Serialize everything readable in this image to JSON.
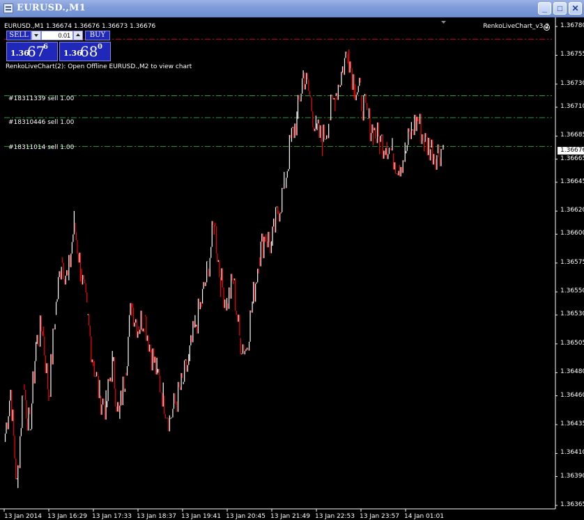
{
  "window": {
    "title": "EURUSD.,M1",
    "minimize_symbol": "_",
    "maximize_symbol": "□",
    "close_symbol": "✕"
  },
  "chart_info": "EURUSD.,M1  1.36674 1.36676 1.36673 1.36676",
  "indicator_name": "RenkoLiveChart_v3.2",
  "renko_message": "RenkoLiveChart(2): Open Offline EURUSD.,M2 to view chart",
  "trade_panel": {
    "sell_label": "SELL",
    "buy_label": "BUY",
    "lot": "0.01",
    "bid": {
      "prefix": "1.36",
      "big": "67",
      "sup": "6"
    },
    "ask": {
      "prefix": "1.36",
      "big": "68",
      "sup": "0"
    }
  },
  "orders": [
    {
      "label": "#18311339 sell 1.00",
      "price": 1.3672
    },
    {
      "label": "#18310446 sell 1.00",
      "price": 1.36701
    },
    {
      "label": "#18311014 sell 1.00",
      "price": 1.36676
    }
  ],
  "current_price": "1.36676",
  "colors": {
    "bear": "#ff0000",
    "bull": "#ffffff",
    "order_line": "#2ba02b",
    "top_line": "#d01010",
    "background": "#000000"
  },
  "chart_data": {
    "type": "line",
    "symbol": "EURUSD.",
    "timeframe": "M1",
    "y_ticks": [
      "1.36780",
      "1.36755",
      "1.36730",
      "1.36710",
      "1.36685",
      "1.36665",
      "1.36645",
      "1.36620",
      "1.36600",
      "1.36575",
      "1.36550",
      "1.36530",
      "1.36505",
      "1.36480",
      "1.36460",
      "1.36435",
      "1.36410",
      "1.36390",
      "1.36365"
    ],
    "x_ticks": [
      "13 Jan 2014",
      "13 Jan 16:29",
      "13 Jan 17:33",
      "13 Jan 18:37",
      "13 Jan 19:41",
      "13 Jan 20:45",
      "13 Jan 21:49",
      "13 Jan 22:53",
      "13 Jan 23:57",
      "14 Jan 01:01"
    ],
    "ylim": [
      1.36362,
      1.36783
    ],
    "top_line_price": 1.36769,
    "close_path": [
      [
        0,
        1.3642
      ],
      [
        1,
        1.36465
      ],
      [
        2,
        1.3638
      ],
      [
        3,
        1.3647
      ],
      [
        4,
        1.3643
      ],
      [
        5,
        1.36505
      ],
      [
        6,
        1.3652
      ],
      [
        7,
        1.3646
      ],
      [
        8,
        1.3653
      ],
      [
        9,
        1.3658
      ],
      [
        10,
        1.3656
      ],
      [
        11,
        1.3661
      ],
      [
        12,
        1.3657
      ],
      [
        13,
        1.3653
      ],
      [
        14,
        1.3649
      ],
      [
        15,
        1.3646
      ],
      [
        16,
        1.3645
      ],
      [
        17,
        1.3649
      ],
      [
        18,
        1.3644
      ],
      [
        19,
        1.3648
      ],
      [
        20,
        1.3654
      ],
      [
        21,
        1.3652
      ],
      [
        22,
        1.3653
      ],
      [
        23,
        1.365
      ],
      [
        24,
        1.3648
      ],
      [
        25,
        1.3646
      ],
      [
        26,
        1.3644
      ],
      [
        27,
        1.36455
      ],
      [
        28,
        1.3647
      ],
      [
        29,
        1.3649
      ],
      [
        30,
        1.3652
      ],
      [
        31,
        1.3654
      ],
      [
        32,
        1.3657
      ],
      [
        33,
        1.3661
      ],
      [
        34,
        1.3656
      ],
      [
        35,
        1.3654
      ],
      [
        36,
        1.3656
      ],
      [
        37,
        1.3651
      ],
      [
        38,
        1.365
      ],
      [
        39,
        1.3654
      ],
      [
        40,
        1.3658
      ],
      [
        41,
        1.366
      ],
      [
        42,
        1.3659
      ],
      [
        43,
        1.3662
      ],
      [
        44,
        1.3664
      ],
      [
        45,
        1.3668
      ],
      [
        46,
        1.367
      ],
      [
        47,
        1.3674
      ],
      [
        48,
        1.3672
      ],
      [
        49,
        1.3669
      ],
      [
        50,
        1.3668
      ],
      [
        51,
        1.367
      ],
      [
        52,
        1.3672
      ],
      [
        53,
        1.3674
      ],
      [
        54,
        1.3676
      ],
      [
        55,
        1.3673
      ],
      [
        56,
        1.3672
      ],
      [
        57,
        1.367
      ],
      [
        58,
        1.3669
      ],
      [
        59,
        1.3668
      ],
      [
        60,
        1.3668
      ],
      [
        61,
        1.3667
      ],
      [
        62,
        1.3666
      ],
      [
        63,
        1.3667
      ],
      [
        64,
        1.3669
      ],
      [
        65,
        1.367
      ],
      [
        66,
        1.3668
      ],
      [
        67,
        1.36675
      ],
      [
        68,
        1.3667
      ],
      [
        69,
        1.36676
      ]
    ]
  }
}
